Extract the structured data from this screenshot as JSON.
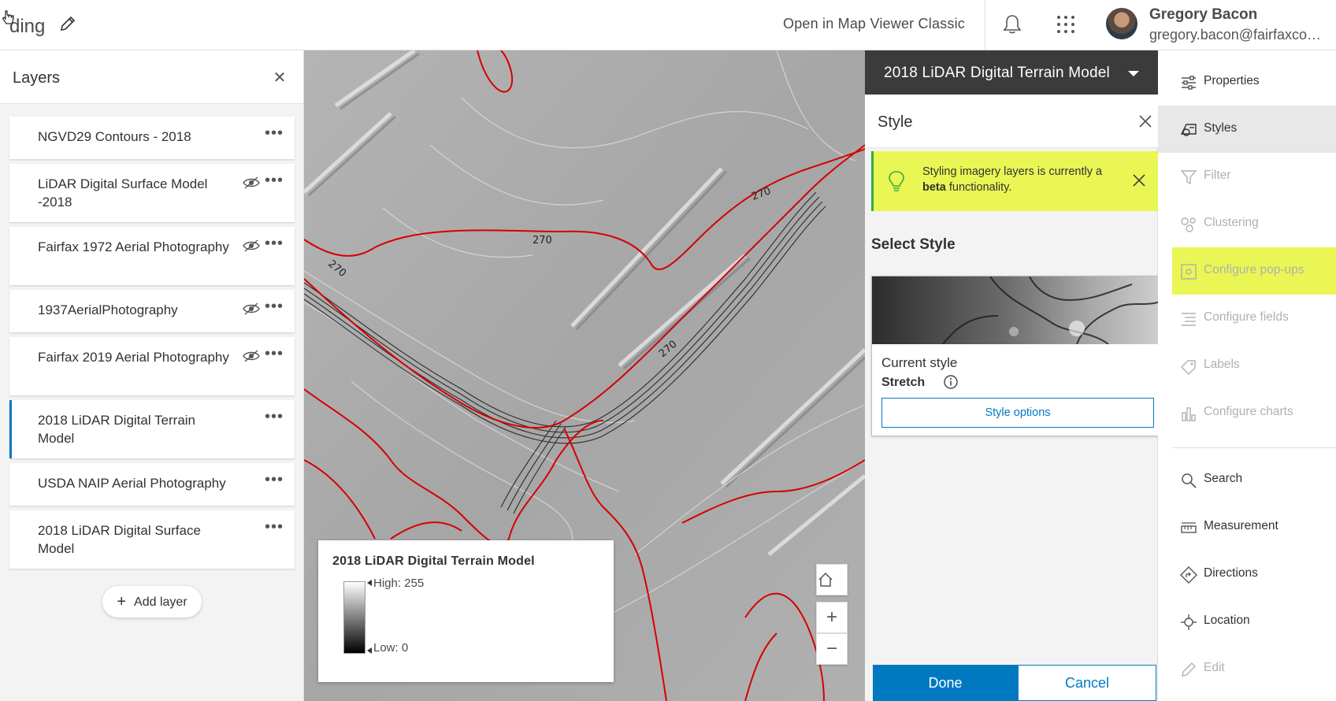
{
  "header": {
    "app_title": "ding",
    "open_classic": "Open in Map Viewer Classic",
    "user_name": "Gregory Bacon",
    "user_email": "gregory.bacon@fairfaxcounty.gov"
  },
  "layers": {
    "title": "Layers",
    "items": [
      {
        "name": "NGVD29 Contours - 2018",
        "eye": false
      },
      {
        "name": "LiDAR Digital Surface Model -2018",
        "eye": true
      },
      {
        "name": "Fairfax 1972 Aerial Photography",
        "eye": true
      },
      {
        "name": "1937AerialPhotography",
        "eye": true
      },
      {
        "name": "Fairfax 2019 Aerial Photography",
        "eye": true
      },
      {
        "name": "2018 LiDAR Digital Terrain Model",
        "eye": false,
        "active": true
      },
      {
        "name": "USDA NAIP Aerial Photography",
        "eye": false
      },
      {
        "name": "2018 LiDAR Digital Surface Model",
        "eye": false
      }
    ],
    "add_layer": "Add layer"
  },
  "map": {
    "contour_labels": [
      "270",
      "270",
      "270",
      "270"
    ],
    "legend": {
      "title": "2018 LiDAR Digital Terrain Model",
      "high": "High: 255",
      "low": "Low: 0"
    }
  },
  "style_panel": {
    "layer_select": "2018 LiDAR Digital Terrain Model",
    "title": "Style",
    "beta_prefix": "Styling imagery layers is currently a ",
    "beta_bold": "beta",
    "beta_suffix": " functionality.",
    "select_style": "Select Style",
    "current_style": "Current style",
    "style_name": "Stretch",
    "style_options": "Style options",
    "done": "Done",
    "cancel": "Cancel"
  },
  "tools": {
    "items": [
      {
        "label": "Properties",
        "icon": "properties-icon"
      },
      {
        "label": "Styles",
        "icon": "styles-icon"
      },
      {
        "label": "Filter",
        "icon": "filter-icon"
      },
      {
        "label": "Clustering",
        "icon": "clustering-icon"
      },
      {
        "label": "Configure pop-ups",
        "icon": "popup-icon"
      },
      {
        "label": "Configure fields",
        "icon": "fields-icon"
      },
      {
        "label": "Labels",
        "icon": "labels-icon"
      },
      {
        "label": "Configure charts",
        "icon": "charts-icon"
      },
      {
        "label": "Search",
        "icon": "search-icon"
      },
      {
        "label": "Measurement",
        "icon": "measurement-icon"
      },
      {
        "label": "Directions",
        "icon": "directions-icon"
      },
      {
        "label": "Location",
        "icon": "location-icon"
      },
      {
        "label": "Edit",
        "icon": "edit-icon"
      }
    ]
  },
  "colors": {
    "accent": "#0079c1",
    "highlight": "#e9f654",
    "contour_red": "#d60000"
  }
}
